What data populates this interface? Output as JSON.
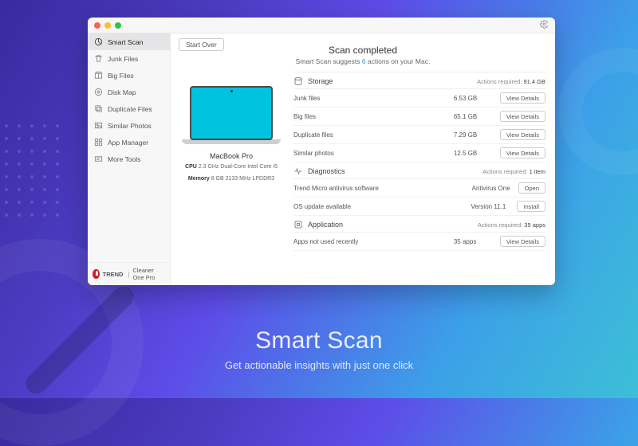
{
  "promo": {
    "title": "Smart Scan",
    "subtitle": "Get actionable insights with just one click"
  },
  "topbar": {
    "start_over": "Start Over"
  },
  "header": {
    "title": "Scan completed",
    "subtitle_pre": "Smart Scan suggests ",
    "count": "6",
    "subtitle_post": " actions on your Mac."
  },
  "sidebar": {
    "items": [
      {
        "label": "Smart Scan",
        "icon": "radar"
      },
      {
        "label": "Junk Files",
        "icon": "trash"
      },
      {
        "label": "Big Files",
        "icon": "box"
      },
      {
        "label": "Disk Map",
        "icon": "disk"
      },
      {
        "label": "Duplicate Files",
        "icon": "dup"
      },
      {
        "label": "Similar Photos",
        "icon": "photo"
      },
      {
        "label": "App Manager",
        "icon": "apps"
      },
      {
        "label": "More Tools",
        "icon": "more"
      }
    ],
    "brand_text": "TREND",
    "product": "Cleaner One Pro"
  },
  "device": {
    "name": "MacBook Pro",
    "cpu_label": "CPU",
    "cpu": "2.3 GHz Dual-Core Intel Core i5",
    "mem_label": "Memory",
    "mem": "8 GB 2133 MHz LPDDR3"
  },
  "cats": [
    {
      "title": "Storage",
      "req_label": "Actions required:",
      "req_value": "91.4 GB",
      "icon": "drive",
      "rows": [
        {
          "label": "Junk files",
          "value": "6.53 GB",
          "action": "View Details"
        },
        {
          "label": "Big files",
          "value": "65.1 GB",
          "action": "View Details"
        },
        {
          "label": "Duplicate files",
          "value": "7.29 GB",
          "action": "View Details"
        },
        {
          "label": "Similar photos",
          "value": "12.5 GB",
          "action": "View Details"
        }
      ]
    },
    {
      "title": "Diagnostics",
      "req_label": "Actions required:",
      "req_value": "1 item",
      "icon": "pulse",
      "rows": [
        {
          "label": "Trend Micro antivirus software",
          "value": "Antivirus One",
          "action": "Open"
        },
        {
          "label": "OS update available",
          "value": "Version 11.1",
          "action": "Install"
        }
      ]
    },
    {
      "title": "Application",
      "req_label": "Actions required:",
      "req_value": "35 apps",
      "icon": "app",
      "rows": [
        {
          "label": "Apps not used recently",
          "value": "35 apps",
          "action": "View Details"
        }
      ]
    }
  ]
}
